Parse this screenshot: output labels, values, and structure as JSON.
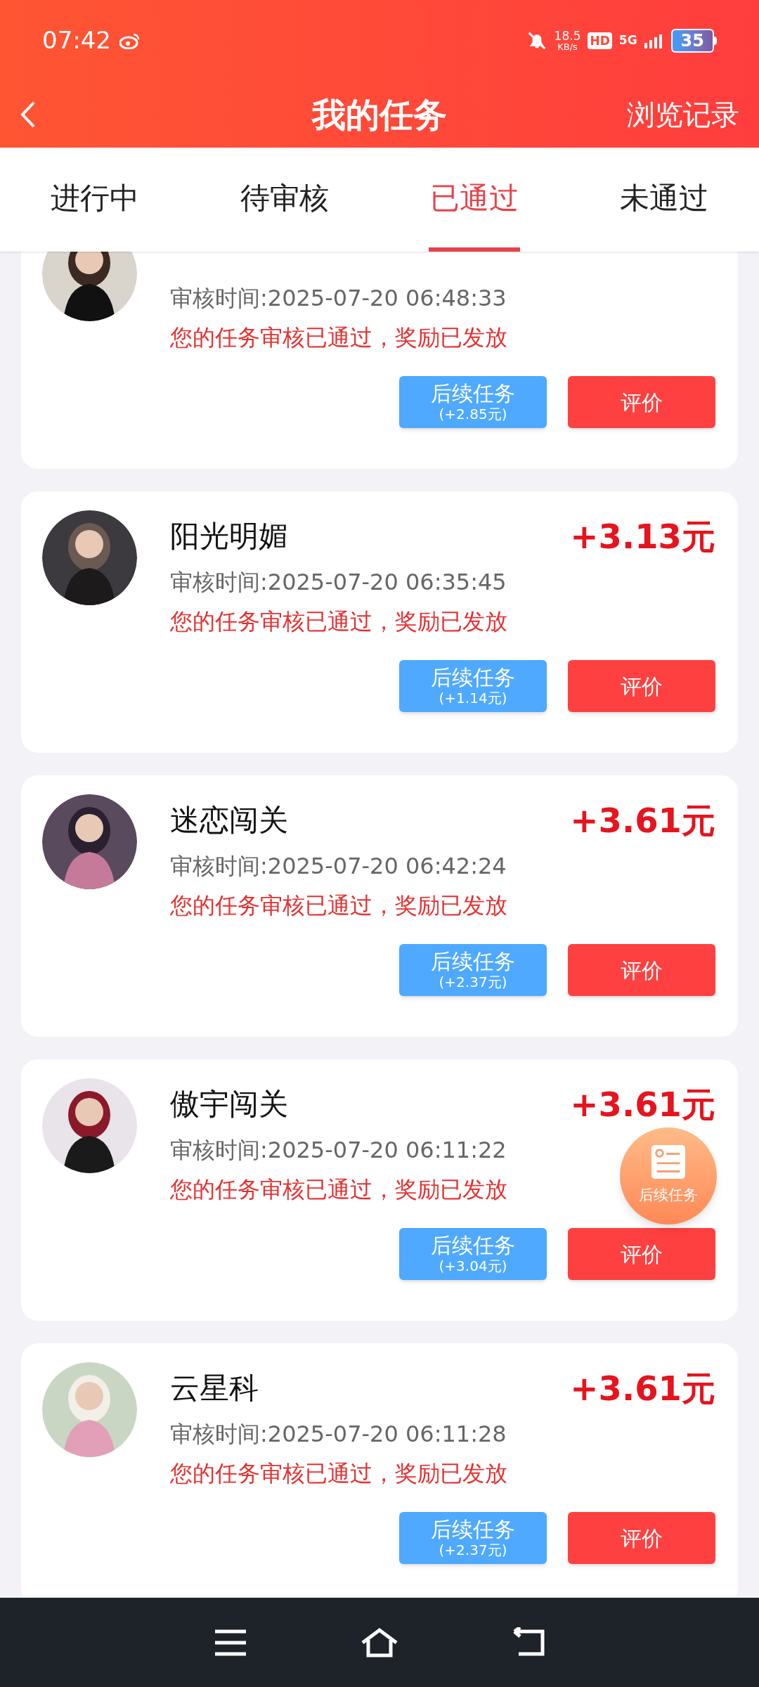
{
  "status_bar": {
    "time": "07:42",
    "net_speed": "18.5",
    "net_unit": "KB/s",
    "hd": "HD",
    "network": "5G",
    "battery": "35"
  },
  "header": {
    "title": "我的任务",
    "action": "浏览记录"
  },
  "tabs": [
    {
      "label": "进行中",
      "selected": false
    },
    {
      "label": "待审核",
      "selected": false
    },
    {
      "label": "已通过",
      "selected": true
    },
    {
      "label": "未通过",
      "selected": false
    }
  ],
  "tasks": [
    {
      "review_time": "审核时间:2025-07-20 06:48:33",
      "status": "您的任务审核已通过，奖励已发放",
      "follow_up": {
        "label": "后续任务",
        "reward": "(+2.85元)"
      },
      "rate_button": "评价"
    },
    {
      "name": "阳光明媚",
      "amount": "+3.13元",
      "review_time": "审核时间:2025-07-20 06:35:45",
      "status": "您的任务审核已通过，奖励已发放",
      "follow_up": {
        "label": "后续任务",
        "reward": "(+1.14元)"
      },
      "rate_button": "评价"
    },
    {
      "name": "迷恋闯关",
      "amount": "+3.61元",
      "review_time": "审核时间:2025-07-20 06:42:24",
      "status": "您的任务审核已通过，奖励已发放",
      "follow_up": {
        "label": "后续任务",
        "reward": "(+2.37元)"
      },
      "rate_button": "评价"
    },
    {
      "name": "傲宇闯关",
      "amount": "+3.61元",
      "review_time": "审核时间:2025-07-20 06:11:22",
      "status": "您的任务审核已通过，奖励已发放",
      "follow_up": {
        "label": "后续任务",
        "reward": "(+3.04元)"
      },
      "rate_button": "评价"
    },
    {
      "name": "云星科",
      "amount": "+3.61元",
      "review_time": "审核时间:2025-07-20 06:11:28",
      "status": "您的任务审核已通过，奖励已发放",
      "follow_up": {
        "label": "后续任务",
        "reward": "(+2.37元)"
      },
      "rate_button": "评价"
    }
  ],
  "floating_button": {
    "label": "后续任务"
  }
}
